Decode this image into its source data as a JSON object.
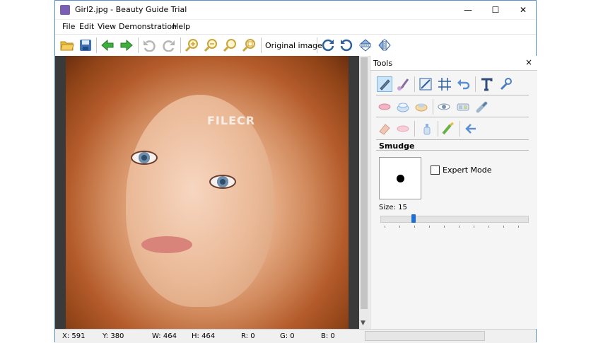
{
  "window": {
    "title": "Girl2.jpg - Beauty Guide Trial",
    "controls": {
      "minimize": "—",
      "maximize": "☐",
      "close": "✕"
    }
  },
  "menu": [
    "File",
    "Edit",
    "View",
    "Demonstration",
    "Help"
  ],
  "toolbar": {
    "original_image_label": "Original image",
    "icons": [
      "open-folder-icon",
      "save-icon",
      "back-arrow-icon",
      "forward-arrow-icon",
      "undo-icon",
      "redo-icon",
      "zoom-in-icon",
      "zoom-out-icon",
      "zoom-fit-icon",
      "zoom-actual-icon",
      "rotate-right-icon",
      "rotate-left-icon",
      "flip-vertical-icon",
      "flip-horizontal-icon"
    ]
  },
  "canvas": {
    "watermark": "FILECR"
  },
  "tools_panel": {
    "title": "Tools",
    "close": "×",
    "section_title": "Smudge",
    "expert_mode_label": "Expert Mode",
    "expert_mode_checked": false,
    "size_label": "Size:",
    "size_value": "15",
    "slider_value": 15,
    "rows": [
      [
        "pencil-icon",
        "brush-icon",
        "resize-icon",
        "grid-crop-icon",
        "undo-tool-icon",
        "text-tool-icon",
        "wrench-icon"
      ],
      [
        "lips-icon",
        "foundation-icon",
        "blush-icon",
        "eye-icon",
        "eyeshadow-icon",
        "mascara-icon"
      ],
      [
        "eraser-icon",
        "lip-gloss-icon",
        "bottle-icon",
        "brush-color-icon",
        "back-arrow-icon"
      ]
    ]
  },
  "status": {
    "x": "X: 591",
    "y": "Y: 380",
    "w": "W: 464",
    "h": "H: 464",
    "r": "R: 0",
    "g": "G: 0",
    "b": "B: 0"
  },
  "colors": {
    "accent": "#1e6fd0",
    "selection": "#cce4f7"
  }
}
